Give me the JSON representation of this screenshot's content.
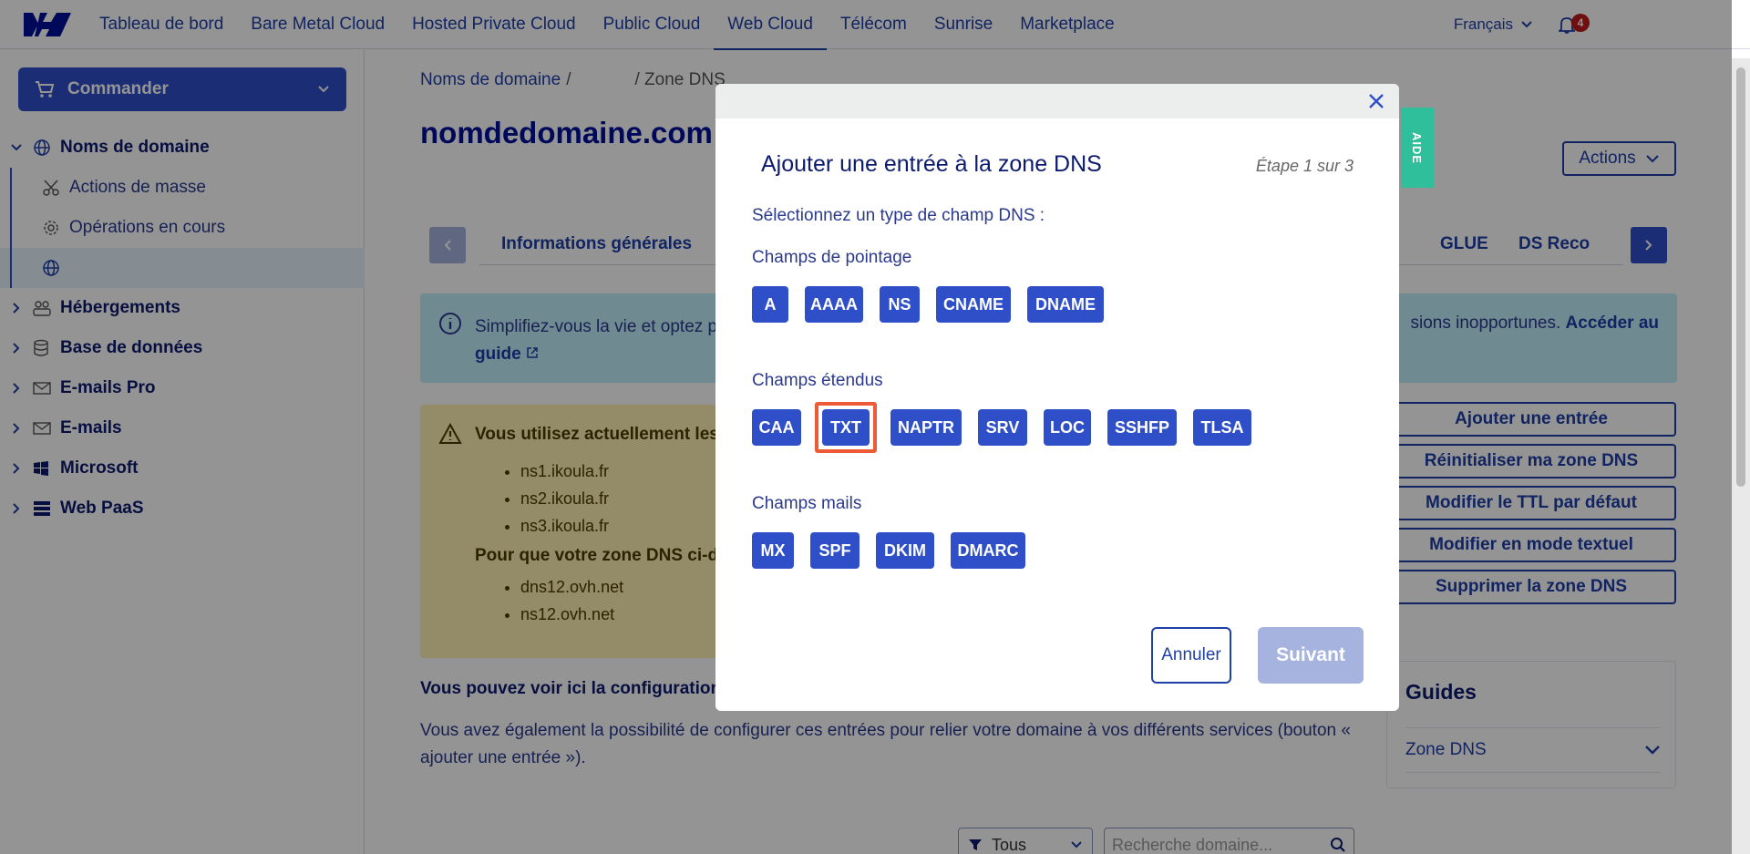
{
  "nav": {
    "items": [
      "Tableau de bord",
      "Bare Metal Cloud",
      "Hosted Private Cloud",
      "Public Cloud",
      "Web Cloud",
      "Télécom",
      "Sunrise",
      "Marketplace"
    ],
    "language": "Français",
    "notifications_count": "4"
  },
  "sidebar": {
    "order_label": "Commander",
    "domain_section": "Noms de domaine",
    "sub_items": [
      "Actions de masse",
      "Opérations en cours"
    ],
    "sections": [
      "Hébergements",
      "Base de données",
      "E-mails Pro",
      "E-mails",
      "Microsoft",
      "Web PaaS"
    ]
  },
  "main": {
    "breadcrumb_1": "Noms de domaine",
    "breadcrumb_sep": "/",
    "breadcrumb_3": "/ Zone DNS",
    "domain_title": "nomdedomaine.com",
    "actions_label": "Actions",
    "tabs": [
      "Informations générales",
      "GLUE",
      "DS Reco"
    ],
    "info_text_1": "Simplifiez-vous la vie et optez p",
    "info_text_2": "sions inopportunes.",
    "info_link_1": "Accéder au",
    "info_link_2": "guide",
    "warn_title": "Vous utilisez actuellement les",
    "warn_list_1": [
      "ns1.ikoula.fr",
      "ns2.ikoula.fr",
      "ns3.ikoula.fr"
    ],
    "warn_title_2": "Pour que votre zone DNS ci-de",
    "warn_list_2": [
      "dns12.ovh.net",
      "ns12.ovh.net"
    ],
    "side_actions": [
      "Ajouter une entrée",
      "Réinitialiser ma zone DNS",
      "Modifier le TTL par défaut",
      "Modifier en mode textuel",
      "Supprimer la zone DNS"
    ],
    "config_title": "Vous pouvez voir ici la configuration",
    "config_text": "Vous avez également la possibilité de configurer ces entrées pour relier votre domaine à vos différents services (bouton « ajouter une entrée »).",
    "guides_title": "Guides",
    "guides_item": "Zone DNS",
    "filter_label": "Tous",
    "search_placeholder": "Recherche domaine..."
  },
  "aide_label": "AIDE",
  "modal": {
    "title": "Ajouter une entrée à la zone DNS",
    "step": "Étape 1 sur 3",
    "select_label": "Sélectionnez un type de champ DNS :",
    "section_pointing": "Champs de pointage",
    "pointing": [
      "A",
      "AAAA",
      "NS",
      "CNAME",
      "DNAME"
    ],
    "section_extended": "Champs étendus",
    "extended": [
      "CAA",
      "TXT",
      "NAPTR",
      "SRV",
      "LOC",
      "SSHFP",
      "TLSA"
    ],
    "section_mail": "Champs mails",
    "mail": [
      "MX",
      "SPF",
      "DKIM",
      "DMARC"
    ],
    "highlighted": "TXT",
    "cancel_label": "Annuler",
    "next_label": "Suivant"
  }
}
